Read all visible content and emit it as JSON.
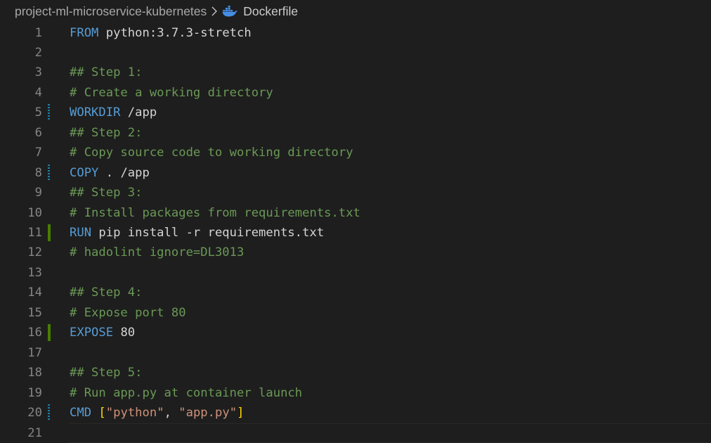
{
  "breadcrumb": {
    "project": "project-ml-microservice-kubernetes",
    "separator_icon": "chevron-right-icon",
    "file_icon": "docker-whale-icon",
    "file": "Dockerfile"
  },
  "colors": {
    "background": "#1e1e1e",
    "keyword": "#569cd6",
    "comment": "#6a9955",
    "string": "#ce9178",
    "bracket": "#ffd700",
    "text": "#d4d4d4",
    "line_number": "#858585",
    "gutter_modified": "#1b81a8",
    "gutter_added": "#487e02"
  },
  "editor": {
    "lines": [
      {
        "num": "1",
        "gutter": "none",
        "tokens": [
          {
            "t": "kw",
            "v": "FROM"
          },
          {
            "t": "txt",
            "v": " python:3.7.3-stretch"
          }
        ]
      },
      {
        "num": "2",
        "gutter": "none",
        "tokens": []
      },
      {
        "num": "3",
        "gutter": "none",
        "tokens": [
          {
            "t": "cm",
            "v": "## Step 1:"
          }
        ]
      },
      {
        "num": "4",
        "gutter": "none",
        "tokens": [
          {
            "t": "cm",
            "v": "# Create a working directory"
          }
        ]
      },
      {
        "num": "5",
        "gutter": "modified",
        "tokens": [
          {
            "t": "kw",
            "v": "WORKDIR"
          },
          {
            "t": "txt",
            "v": " /app"
          }
        ]
      },
      {
        "num": "6",
        "gutter": "none",
        "tokens": [
          {
            "t": "cm",
            "v": "## Step 2:"
          }
        ]
      },
      {
        "num": "7",
        "gutter": "none",
        "tokens": [
          {
            "t": "cm",
            "v": "# Copy source code to working directory"
          }
        ]
      },
      {
        "num": "8",
        "gutter": "modified",
        "tokens": [
          {
            "t": "kw",
            "v": "COPY"
          },
          {
            "t": "txt",
            "v": " . /app"
          }
        ]
      },
      {
        "num": "9",
        "gutter": "none",
        "tokens": [
          {
            "t": "cm",
            "v": "## Step 3:"
          }
        ]
      },
      {
        "num": "10",
        "gutter": "none",
        "tokens": [
          {
            "t": "cm",
            "v": "# Install packages from requirements.txt"
          }
        ]
      },
      {
        "num": "11",
        "gutter": "added",
        "tokens": [
          {
            "t": "kw",
            "v": "RUN"
          },
          {
            "t": "txt",
            "v": " pip install -r requirements.txt"
          }
        ]
      },
      {
        "num": "12",
        "gutter": "none",
        "tokens": [
          {
            "t": "cm",
            "v": "# hadolint ignore=DL3013"
          }
        ]
      },
      {
        "num": "13",
        "gutter": "none",
        "tokens": []
      },
      {
        "num": "14",
        "gutter": "none",
        "tokens": [
          {
            "t": "cm",
            "v": "## Step 4:"
          }
        ]
      },
      {
        "num": "15",
        "gutter": "none",
        "tokens": [
          {
            "t": "cm",
            "v": "# Expose port 80"
          }
        ]
      },
      {
        "num": "16",
        "gutter": "added",
        "tokens": [
          {
            "t": "kw",
            "v": "EXPOSE"
          },
          {
            "t": "num",
            "v": " 80"
          }
        ]
      },
      {
        "num": "17",
        "gutter": "none",
        "tokens": []
      },
      {
        "num": "18",
        "gutter": "none",
        "tokens": [
          {
            "t": "cm",
            "v": "## Step 5:"
          }
        ]
      },
      {
        "num": "19",
        "gutter": "none",
        "tokens": [
          {
            "t": "cm",
            "v": "# Run app.py at container launch"
          }
        ]
      },
      {
        "num": "20",
        "gutter": "modified",
        "tokens": [
          {
            "t": "kw",
            "v": "CMD"
          },
          {
            "t": "txt",
            "v": " "
          },
          {
            "t": "br",
            "v": "["
          },
          {
            "t": "str",
            "v": "\"python\""
          },
          {
            "t": "txt",
            "v": ", "
          },
          {
            "t": "str",
            "v": "\"app.py\""
          },
          {
            "t": "br",
            "v": "]"
          }
        ]
      },
      {
        "num": "21",
        "gutter": "none",
        "tokens": [],
        "cursor": true
      }
    ]
  }
}
